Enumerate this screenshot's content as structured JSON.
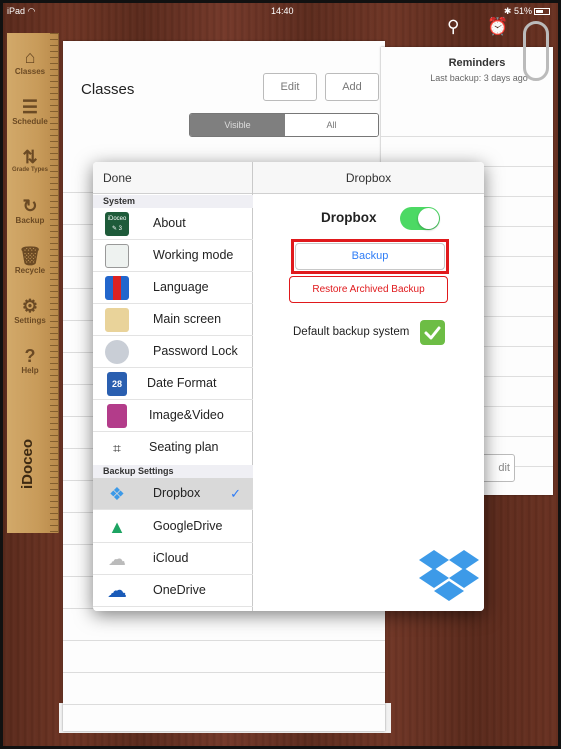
{
  "status_bar": {
    "device": "iPad",
    "time": "14:40",
    "battery": "51%"
  },
  "sidebar": {
    "items": [
      {
        "label": "Classes",
        "icon": "home-icon"
      },
      {
        "label": "Schedule",
        "icon": "schedule-icon"
      },
      {
        "label": "Grade Types",
        "icon": "grade-types-icon"
      },
      {
        "label": "Backup",
        "icon": "backup-icon"
      },
      {
        "label": "Recycle",
        "icon": "trash-icon"
      },
      {
        "label": "Settings",
        "icon": "gear-icon"
      },
      {
        "label": "Help",
        "icon": "help-icon"
      }
    ],
    "brand": "iDoceo"
  },
  "background": {
    "classes_title": "Classes",
    "edit_label": "Edit",
    "add_label": "Add",
    "segment_visible": "Visible",
    "segment_all": "All",
    "reminders_title": "Reminders",
    "reminders_sub": "Last backup: 3 days ago",
    "edit_partial": "dit"
  },
  "modal": {
    "done_label": "Done",
    "right_title": "Dropbox",
    "sections": {
      "system": "System",
      "backup_settings": "Backup Settings"
    },
    "system_items": [
      {
        "label": "About",
        "icon": "idoceo-app-icon",
        "icon_text": "iDoceo"
      },
      {
        "label": "Working mode",
        "icon": "working-mode-icon"
      },
      {
        "label": "Language",
        "icon": "language-flags-icon"
      },
      {
        "label": "Main screen",
        "icon": "main-screen-icon"
      },
      {
        "label": "Password Lock",
        "icon": "padlock-icon"
      },
      {
        "label": "Date Format",
        "icon": "calendar-icon",
        "icon_text": "28"
      },
      {
        "label": "Image&Video",
        "icon": "image-video-icon"
      },
      {
        "label": "Seating plan",
        "icon": "seating-plan-icon"
      }
    ],
    "backup_items": [
      {
        "label": "Dropbox",
        "icon": "dropbox-icon",
        "selected": true
      },
      {
        "label": "GoogleDrive",
        "icon": "google-drive-icon"
      },
      {
        "label": "iCloud",
        "icon": "icloud-icon"
      },
      {
        "label": "OneDrive",
        "icon": "onedrive-icon"
      }
    ],
    "dropbox_label": "Dropbox",
    "dropbox_enabled": true,
    "backup_button": "Backup",
    "restore_button": "Restore Archived Backup",
    "default_label": "Default backup system",
    "default_checked": true
  },
  "colors": {
    "accent_blue": "#2e7cf6",
    "toggle_green": "#4cd964",
    "check_green": "#6dbd45",
    "highlight_red": "#e0191c",
    "dropbox_blue": "#3d9ae8"
  }
}
